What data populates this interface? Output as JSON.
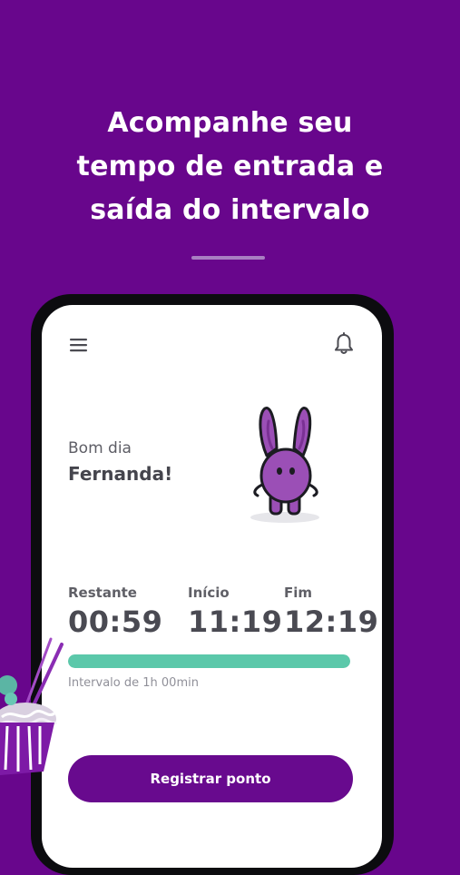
{
  "headline": {
    "line1": "Acompanhe seu",
    "line2": "tempo de entrada e",
    "line3": "saída do intervalo"
  },
  "app": {
    "greeting": "Bom dia",
    "user_name": "Fernanda!",
    "stats": [
      {
        "label": "Restante",
        "value": "00:59"
      },
      {
        "label": "Início",
        "value": "11:19"
      },
      {
        "label": "Fim",
        "value": "12:19"
      }
    ],
    "progress_fraction": 1.0,
    "interval_note": "Intervalo de 1h 00min",
    "register_button": "Registrar ponto"
  },
  "icons": [
    "menu-icon",
    "bell-icon",
    "bunny-mascot",
    "food-bowl-illustration"
  ],
  "colors": {
    "background": "#68068c",
    "accent_green": "#5bc8aa",
    "button": "#680a8e",
    "mascot": "#9b4fb6"
  }
}
